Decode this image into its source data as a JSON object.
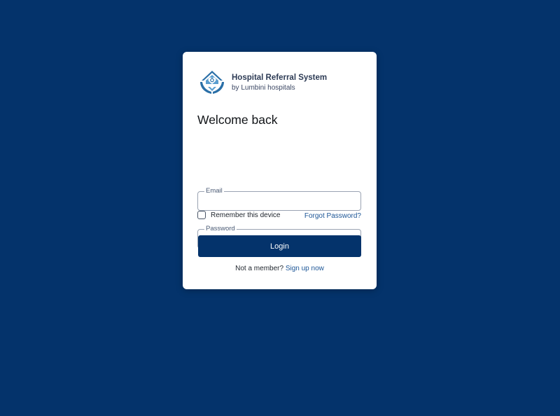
{
  "brand": {
    "title": "Hospital Referral System",
    "subtitle": "by Lumbini hospitals",
    "logo_icon": "house-hands-heart-icon",
    "logo_colors": {
      "primary": "#2a6fa7",
      "accent": "#5a9ed0"
    }
  },
  "login": {
    "heading": "Welcome back",
    "email_label": "Email",
    "email_value": "",
    "password_label": "Password",
    "password_value": "",
    "remember_label": "Remember this device",
    "remember_checked": false,
    "forgot_label": "Forgot Password?",
    "button_label": "Login",
    "signup_prompt": "Not a member?",
    "signup_link": "Sign up now"
  },
  "colors": {
    "background": "#04336b",
    "button": "#04336b",
    "link": "#1c5596"
  }
}
